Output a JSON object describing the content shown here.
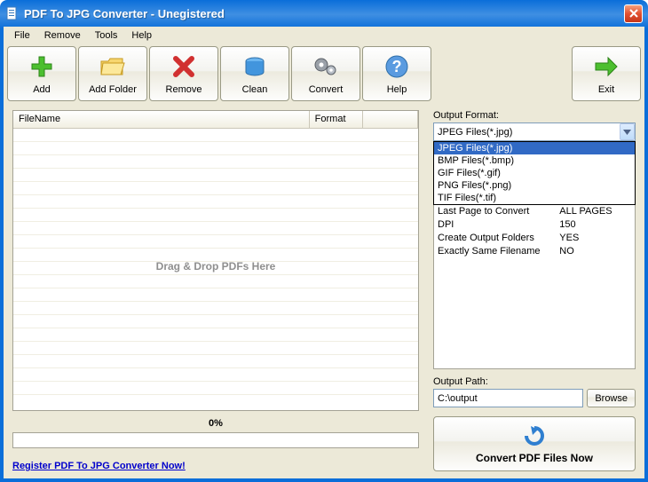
{
  "window": {
    "title": "PDF To JPG Converter - Unegistered"
  },
  "menu": {
    "file": "File",
    "remove": "Remove",
    "tools": "Tools",
    "help": "Help"
  },
  "toolbar": {
    "add": "Add",
    "add_folder": "Add Folder",
    "remove": "Remove",
    "clean": "Clean",
    "convert": "Convert",
    "help": "Help",
    "exit": "Exit"
  },
  "filelist": {
    "col_name": "FileName",
    "col_format": "Format",
    "drop_hint": "Drag & Drop PDFs Here"
  },
  "progress": {
    "label": "0%"
  },
  "register_link": "Register PDF To JPG Converter Now!",
  "right": {
    "format_label": "Output Format:",
    "format_selected": "JPEG Files(*.jpg)",
    "format_options": [
      "JPEG Files(*.jpg)",
      "BMP Files(*.bmp)",
      "GIF Files(*.gif)",
      "PNG Files(*.png)",
      "TIF Files(*.tif)"
    ],
    "settings": [
      {
        "key": "Last Page to Convert",
        "val": "ALL PAGES"
      },
      {
        "key": "DPI",
        "val": "150"
      },
      {
        "key": "Create Output Folders",
        "val": "YES"
      },
      {
        "key": "Exactly Same Filename",
        "val": "NO"
      }
    ],
    "path_label": "Output Path:",
    "path_value": "C:\\output",
    "browse": "Browse",
    "convert_now": "Convert PDF Files Now"
  }
}
